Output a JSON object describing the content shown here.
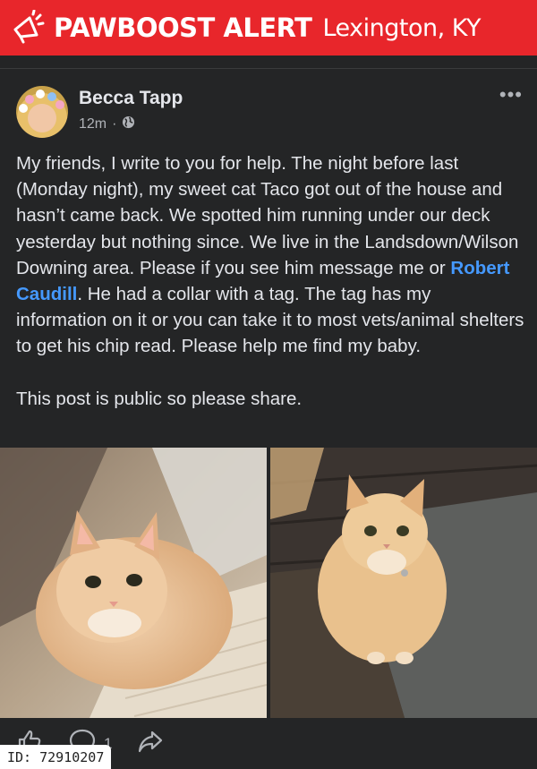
{
  "banner": {
    "icon": "megaphone-icon",
    "brand": "PAWBOOST ALERT",
    "location": "Lexington, KY",
    "color": "#e8262b"
  },
  "post": {
    "author": "Becca Tapp",
    "time": "12m",
    "audience_icon": "globe-icon",
    "more_icon": "more-options-icon",
    "paragraph_before_mention": "My friends, I write to you for help. The night before last (Monday night), my sweet cat Taco got out of the house and hasn’t came back. We spotted him running under our deck yesterday but nothing since. We live in the Landsdown/Wilson Downing area. Please if you see him message me or ",
    "mention": "Robert Caudill",
    "paragraph_after_mention": ". He had a collar with a tag. The tag has my information on it or you can take it to most vets/animal shelters to get his chip read. Please help me find my baby.",
    "closing": "This post is public so please share.",
    "mention_color": "#4599ff"
  },
  "actions": {
    "like_icon": "like-icon",
    "comment_icon": "comment-icon",
    "comment_count": "1",
    "share_icon": "share-icon"
  },
  "listing": {
    "id_label": "ID: 72910207"
  }
}
